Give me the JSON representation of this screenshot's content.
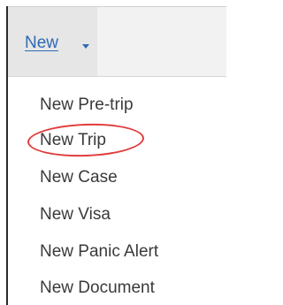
{
  "nav": {
    "new_label": "New"
  },
  "menu": {
    "items": [
      {
        "label": "New Pre-trip"
      },
      {
        "label": "New Trip"
      },
      {
        "label": "New Case"
      },
      {
        "label": "New Visa"
      },
      {
        "label": "New Panic Alert"
      },
      {
        "label": "New Document"
      }
    ]
  },
  "highlight": {
    "target": "New Trip",
    "color": "#e23b3b"
  },
  "colors": {
    "link": "#2f6ab4",
    "menu_text": "#3a3a3a",
    "nav_active_bg": "#e6e6e6"
  },
  "icons": {
    "caret": "caret-down-icon"
  }
}
